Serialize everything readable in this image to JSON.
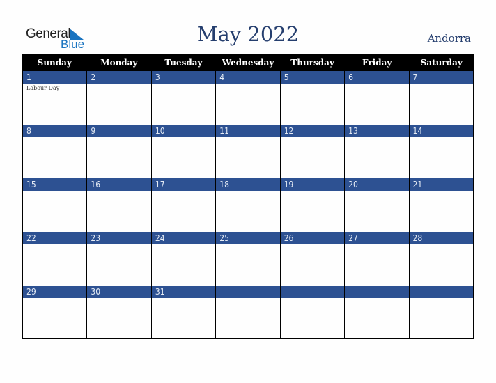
{
  "logo": {
    "line1": "General",
    "line2": "Blue"
  },
  "title": "May 2022",
  "country": "Andorra",
  "weekdays": [
    "Sunday",
    "Monday",
    "Tuesday",
    "Wednesday",
    "Thursday",
    "Friday",
    "Saturday"
  ],
  "weeks": [
    {
      "days": [
        {
          "num": "1",
          "event": "Labour Day"
        },
        {
          "num": "2",
          "event": ""
        },
        {
          "num": "3",
          "event": ""
        },
        {
          "num": "4",
          "event": ""
        },
        {
          "num": "5",
          "event": ""
        },
        {
          "num": "6",
          "event": ""
        },
        {
          "num": "7",
          "event": ""
        }
      ]
    },
    {
      "days": [
        {
          "num": "8",
          "event": ""
        },
        {
          "num": "9",
          "event": ""
        },
        {
          "num": "10",
          "event": ""
        },
        {
          "num": "11",
          "event": ""
        },
        {
          "num": "12",
          "event": ""
        },
        {
          "num": "13",
          "event": ""
        },
        {
          "num": "14",
          "event": ""
        }
      ]
    },
    {
      "days": [
        {
          "num": "15",
          "event": ""
        },
        {
          "num": "16",
          "event": ""
        },
        {
          "num": "17",
          "event": ""
        },
        {
          "num": "18",
          "event": ""
        },
        {
          "num": "19",
          "event": ""
        },
        {
          "num": "20",
          "event": ""
        },
        {
          "num": "21",
          "event": ""
        }
      ]
    },
    {
      "days": [
        {
          "num": "22",
          "event": ""
        },
        {
          "num": "23",
          "event": ""
        },
        {
          "num": "24",
          "event": ""
        },
        {
          "num": "25",
          "event": ""
        },
        {
          "num": "26",
          "event": ""
        },
        {
          "num": "27",
          "event": ""
        },
        {
          "num": "28",
          "event": ""
        }
      ]
    },
    {
      "days": [
        {
          "num": "29",
          "event": ""
        },
        {
          "num": "30",
          "event": ""
        },
        {
          "num": "31",
          "event": ""
        },
        {
          "num": "",
          "event": ""
        },
        {
          "num": "",
          "event": ""
        },
        {
          "num": "",
          "event": ""
        },
        {
          "num": "",
          "event": ""
        }
      ]
    }
  ],
  "colors": {
    "header_bg": "#000000",
    "day_bar": "#2d5192",
    "title": "#253e6e",
    "logo_blue": "#1a74c0"
  }
}
